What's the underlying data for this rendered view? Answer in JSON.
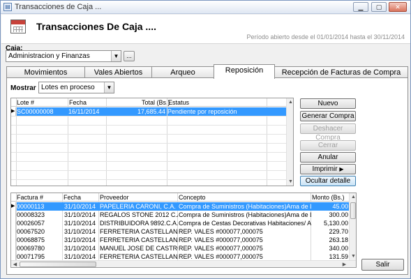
{
  "window": {
    "title": "Transacciones de Caja ..."
  },
  "header": {
    "heading": "Transacciones De Caja ....",
    "period": "Período abierto desde el 01/01/2014 hasta el 30/11/2014"
  },
  "caja": {
    "label": "Caja:",
    "selected": "Administracion y Finanzas",
    "browse_label": "..."
  },
  "tabs": [
    {
      "label": "Movimientos",
      "active": false
    },
    {
      "label": "Vales Abiertos",
      "active": false
    },
    {
      "label": "Arqueo",
      "active": false
    },
    {
      "label": "Reposición",
      "active": true
    },
    {
      "label": "Recepción de Facturas de Compra",
      "active": false
    }
  ],
  "mostrar": {
    "label": "Mostrar",
    "selected": "Lotes en proceso"
  },
  "lotes_table": {
    "headers": [
      "Lote #",
      "Fecha",
      "Total (Bs.)",
      "Estatus"
    ],
    "rows": [
      {
        "lote": "SC00000008",
        "fecha": "16/11/2014",
        "total": "17,685.44",
        "estatus": "Pendiente por reposición",
        "selected": true
      }
    ]
  },
  "actions": {
    "nuevo": "Nuevo",
    "generar_compra": "Generar Compra",
    "deshacer_compra": "Deshacer Compra",
    "cerrar": "Cerrar",
    "anular": "Anular",
    "imprimir": "Imprimir",
    "ocultar_detalle": "Ocultar detalle"
  },
  "facturas_table": {
    "headers": [
      "Factura #",
      "Fecha",
      "Proveedor",
      "Concepto",
      "Monto  (Bs.)"
    ],
    "rows": [
      {
        "factura": "00000113",
        "fecha": "31/10/2014",
        "proveedor": "PAPELERIA CARONI, C.A.",
        "concepto": "Compra de Suministros (Habitaciones)Ama de LLaves",
        "monto": "45.00",
        "selected": true
      },
      {
        "factura": "00008323",
        "fecha": "31/10/2014",
        "proveedor": "REGALOS STONE 2012 C.A.",
        "concepto": "Compra de Suministros (Habitaciones)Ama de LLaves",
        "monto": "300.00"
      },
      {
        "factura": "00026057",
        "fecha": "31/10/2014",
        "proveedor": "DISTRIBUIDORA 9892.C.A.",
        "concepto": "Compra de Cestas Decorativas Habitaciones/ Ama de",
        "monto": "5,130.00"
      },
      {
        "factura": "00067520",
        "fecha": "31/10/2014",
        "proveedor": "FERRETERIA CASTELLANA PLA",
        "concepto": "REP. VALES #000077,000075",
        "monto": "229.70"
      },
      {
        "factura": "00068875",
        "fecha": "31/10/2014",
        "proveedor": "FERRETERIA CASTELLANA PLA",
        "concepto": "REP. VALES #000077,000075",
        "monto": "263.18"
      },
      {
        "factura": "00069780",
        "fecha": "31/10/2014",
        "proveedor": "MANUEL JOSE DE CASTRO FER",
        "concepto": "REP. VALES #000077,000075",
        "monto": "340.00"
      },
      {
        "factura": "00071795",
        "fecha": "31/10/2014",
        "proveedor": "FERRETERIA CASTELLANA PLA",
        "concepto": "REP. VALES #000077,000075",
        "monto": "131.59"
      }
    ]
  },
  "salir": "Salir",
  "colors": {
    "selection": "#3399ff",
    "calendar_band": "#c8423a"
  },
  "icons": {
    "app": "window-icon",
    "calendar": "calendar-icon",
    "dropdown": "chevron-down-icon",
    "row_pointer": "triangle-right-icon"
  }
}
